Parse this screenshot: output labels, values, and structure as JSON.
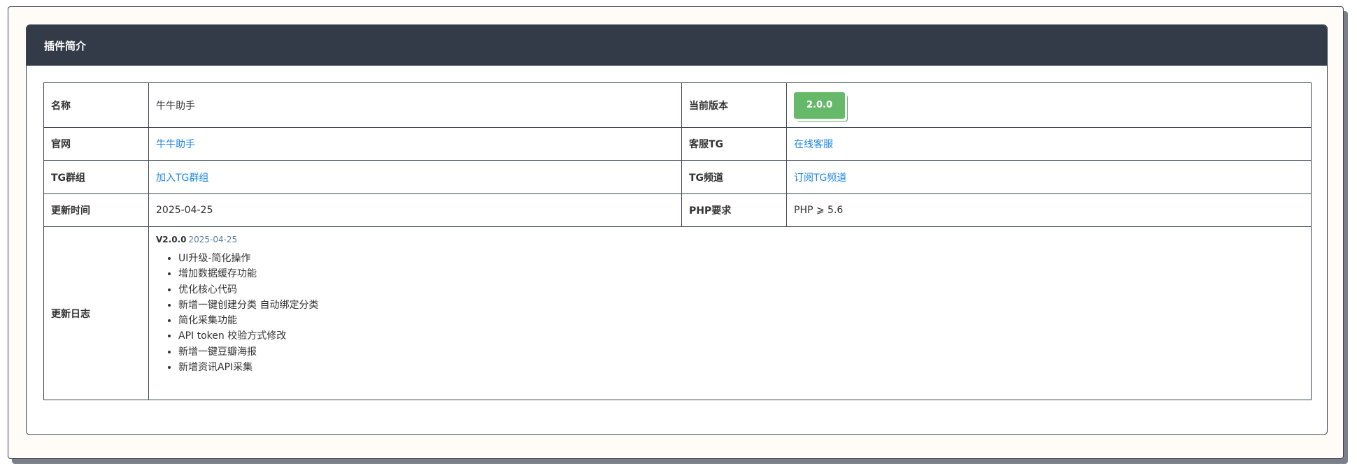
{
  "panel": {
    "title": "插件简介"
  },
  "info": {
    "name_label": "名称",
    "name_value": "牛牛助手",
    "version_label": "当前版本",
    "version_value": "2.0.0",
    "website_label": "官网",
    "website_link": "牛牛助手",
    "support_label": "客服TG",
    "support_link": "在线客服",
    "group_label": "TG群组",
    "group_link": "加入TG群组",
    "channel_label": "TG频道",
    "channel_link": "订阅TG频道",
    "updated_label": "更新时间",
    "updated_value": "2025-04-25",
    "php_label": "PHP要求",
    "php_value": "PHP ⩾ 5.6",
    "changelog_label": "更新日志"
  },
  "changelog": {
    "version": "V2.0.0",
    "date": "2025-04-25",
    "items": [
      "UI升级-简化操作",
      "增加数据缓存功能",
      "优化核心代码",
      "新增一键创建分类 自动绑定分类",
      "简化采集功能",
      "API token 校验方式修改",
      "新增一键豆瓣海报",
      "新增资讯API采集"
    ]
  },
  "colors": {
    "header_bg": "#333b48",
    "link": "#1e88e5",
    "badge": "#67b96a"
  }
}
